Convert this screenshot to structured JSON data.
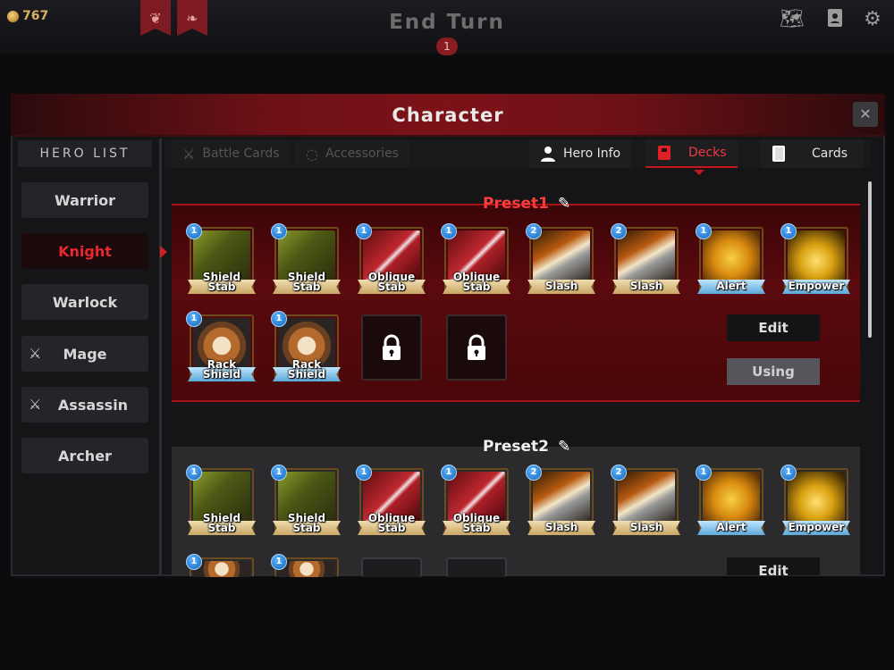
{
  "topbar": {
    "gold": "767",
    "end_turn": "End Turn",
    "turn_number": "1"
  },
  "dialog": {
    "title": "Character",
    "close_glyph": "✕"
  },
  "hero_list": {
    "header": "HERO LIST",
    "heroes": [
      {
        "name": "Warrior",
        "locked": false,
        "selected": false
      },
      {
        "name": "Knight",
        "locked": false,
        "selected": true
      },
      {
        "name": "Warlock",
        "locked": false,
        "selected": false
      },
      {
        "name": "Mage",
        "locked": true,
        "selected": false
      },
      {
        "name": "Assassin",
        "locked": true,
        "selected": false
      },
      {
        "name": "Archer",
        "locked": false,
        "selected": false
      }
    ]
  },
  "tabs": {
    "battle_cards": "Battle Cards",
    "accessories": "Accessories",
    "hero_info": "Hero Info",
    "decks": "Decks",
    "cards": "Cards",
    "active": "Decks"
  },
  "presets": [
    {
      "name": "Preset1",
      "edit_label": "Edit",
      "using_label": "Using",
      "cards": [
        {
          "line1": "Shield",
          "line2": "Stab",
          "count": "1",
          "art": "shield-stab"
        },
        {
          "line1": "Shield",
          "line2": "Stab",
          "count": "1",
          "art": "shield-stab"
        },
        {
          "line1": "Oblique",
          "line2": "Stab",
          "count": "1",
          "art": "oblique-stab"
        },
        {
          "line1": "Oblique",
          "line2": "Stab",
          "count": "1",
          "art": "oblique-stab"
        },
        {
          "line1": "Slash",
          "line2": "",
          "count": "2",
          "art": "slash"
        },
        {
          "line1": "Slash",
          "line2": "",
          "count": "2",
          "art": "slash"
        },
        {
          "line1": "Alert",
          "line2": "",
          "count": "1",
          "art": "alert"
        },
        {
          "line1": "Empower",
          "line2": "",
          "count": "1",
          "art": "empower"
        },
        {
          "line1": "Rack",
          "line2": "Shield",
          "count": "1",
          "art": "rack-shield"
        },
        {
          "line1": "Rack",
          "line2": "Shield",
          "count": "1",
          "art": "rack-shield"
        }
      ]
    },
    {
      "name": "Preset2",
      "edit_label": "Edit",
      "cards": [
        {
          "line1": "Shield",
          "line2": "Stab",
          "count": "1",
          "art": "shield-stab"
        },
        {
          "line1": "Shield",
          "line2": "Stab",
          "count": "1",
          "art": "shield-stab"
        },
        {
          "line1": "Oblique",
          "line2": "Stab",
          "count": "1",
          "art": "oblique-stab"
        },
        {
          "line1": "Oblique",
          "line2": "Stab",
          "count": "1",
          "art": "oblique-stab"
        },
        {
          "line1": "Slash",
          "line2": "",
          "count": "2",
          "art": "slash"
        },
        {
          "line1": "Slash",
          "line2": "",
          "count": "2",
          "art": "slash"
        },
        {
          "line1": "Alert",
          "line2": "",
          "count": "1",
          "art": "alert"
        },
        {
          "line1": "Empower",
          "line2": "",
          "count": "1",
          "art": "empower"
        },
        {
          "line1": "",
          "line2": "",
          "count": "1",
          "art": "rack-shield"
        },
        {
          "line1": "",
          "line2": "",
          "count": "1",
          "art": "rack-shield"
        }
      ]
    }
  ],
  "colors": {
    "accent_red": "#d02026",
    "count_badge": "#1464b8"
  }
}
